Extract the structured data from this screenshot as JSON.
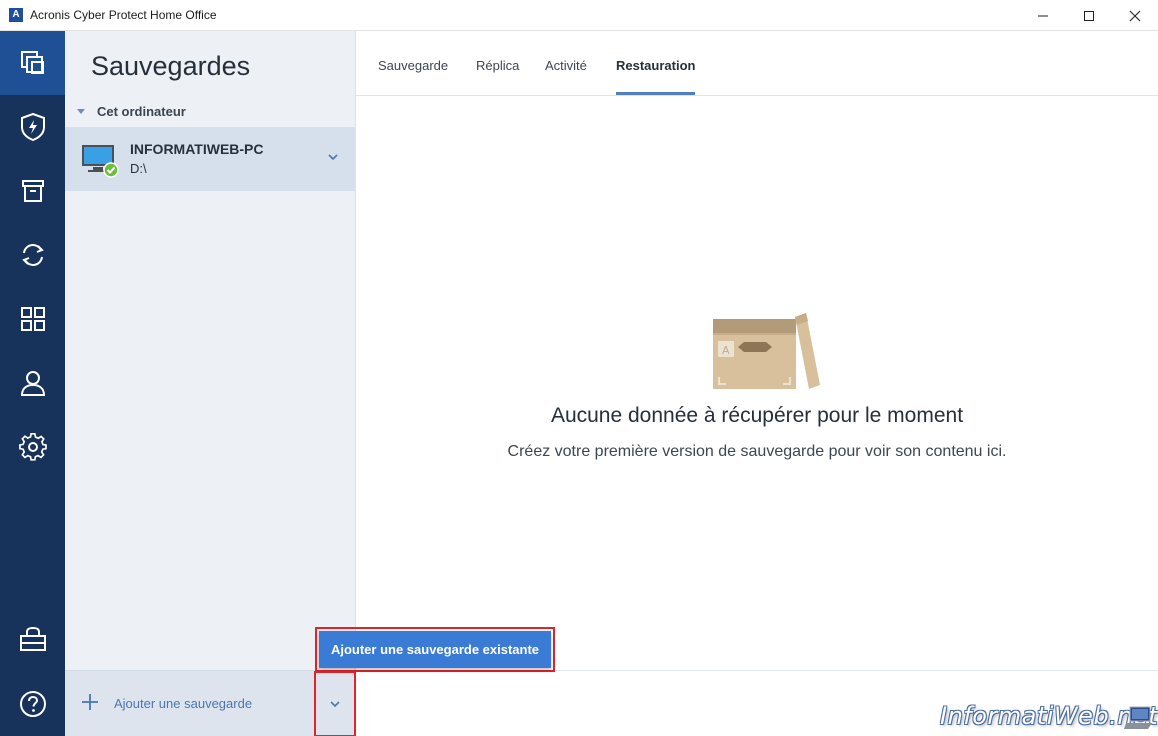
{
  "window": {
    "title": "Acronis Cyber Protect Home Office",
    "logo_letter": "A"
  },
  "sidebar": {
    "items": [
      {
        "name": "backup",
        "icon": "backup-copies-icon",
        "active": true
      },
      {
        "name": "protection",
        "icon": "shield-bolt-icon",
        "active": false
      },
      {
        "name": "archive",
        "icon": "archive-box-icon",
        "active": false
      },
      {
        "name": "sync",
        "icon": "sync-icon",
        "active": false
      },
      {
        "name": "tools",
        "icon": "grid-tools-icon",
        "active": false
      },
      {
        "name": "account",
        "icon": "user-icon",
        "active": false
      },
      {
        "name": "settings",
        "icon": "gear-icon",
        "active": false
      },
      {
        "name": "store",
        "icon": "shopping-bag-icon",
        "active": false
      },
      {
        "name": "help",
        "icon": "help-circle-icon",
        "active": false
      }
    ]
  },
  "panel": {
    "title": "Sauvegardes",
    "group_label": "Cet ordinateur",
    "backup_item": {
      "name": "INFORMATIWEB-PC",
      "destination": "D:\\",
      "status": "ok"
    },
    "footer": {
      "add_label": "Ajouter une sauvegarde"
    }
  },
  "tabs": [
    {
      "label": "Sauvegarde",
      "active": false
    },
    {
      "label": "Réplica",
      "active": false
    },
    {
      "label": "Activité",
      "active": false
    },
    {
      "label": "Restauration",
      "active": true
    }
  ],
  "main": {
    "empty_title": "Aucune donnée à récupérer pour le moment",
    "empty_subtitle": "Créez votre première version de sauvegarde pour voir son contenu ici."
  },
  "popup": {
    "label": "Ajouter une sauvegarde existante"
  },
  "watermark": {
    "text": "InformatiWeb.net"
  },
  "colors": {
    "rail_bg": "#17325b",
    "rail_active": "#1f4f94",
    "panel_bg": "#edf0f5",
    "selected_item": "#d6dfec",
    "accent": "#3a7bd5",
    "highlight_red": "#e2232b"
  }
}
